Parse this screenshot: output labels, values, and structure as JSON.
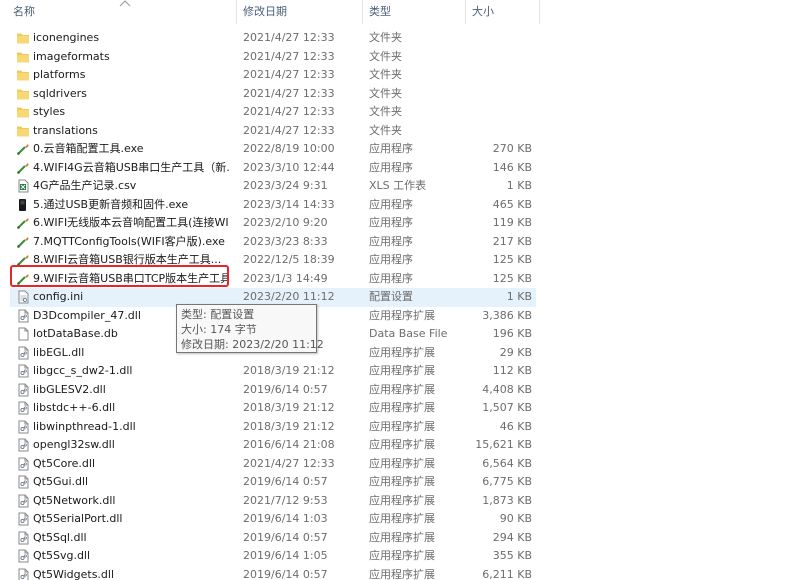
{
  "header": {
    "name": "名称",
    "date": "修改日期",
    "type": "类型",
    "size": "大小"
  },
  "rows": [
    {
      "name": "iconengines",
      "date": "2021/4/27 12:33",
      "type": "文件夹",
      "size": "",
      "icon": "folder-icon"
    },
    {
      "name": "imageformats",
      "date": "2021/4/27 12:33",
      "type": "文件夹",
      "size": "",
      "icon": "folder-icon"
    },
    {
      "name": "platforms",
      "date": "2021/4/27 12:33",
      "type": "文件夹",
      "size": "",
      "icon": "folder-icon"
    },
    {
      "name": "sqldrivers",
      "date": "2021/4/27 12:33",
      "type": "文件夹",
      "size": "",
      "icon": "folder-icon"
    },
    {
      "name": "styles",
      "date": "2021/4/27 12:33",
      "type": "文件夹",
      "size": "",
      "icon": "folder-icon"
    },
    {
      "name": "translations",
      "date": "2021/4/27 12:33",
      "type": "文件夹",
      "size": "",
      "icon": "folder-icon"
    },
    {
      "name": "0.云音箱配置工具.exe",
      "date": "2022/8/19 10:00",
      "type": "应用程序",
      "size": "270 KB",
      "icon": "app-icon"
    },
    {
      "name": "4.WIFI4G云音箱USB串口生产工具（新...",
      "date": "2023/3/10 12:44",
      "type": "应用程序",
      "size": "146 KB",
      "icon": "app-icon"
    },
    {
      "name": "4G产品生产记录.csv",
      "date": "2023/3/24 9:31",
      "type": "XLS 工作表",
      "size": "1 KB",
      "icon": "csv-icon"
    },
    {
      "name": "5.通过USB更新音频和固件.exe",
      "date": "2023/3/14 14:33",
      "type": "应用程序",
      "size": "465 KB",
      "icon": "exe-icon"
    },
    {
      "name": "6.WIFI无线版本云音响配置工具(连接WI...",
      "date": "2023/2/10 9:20",
      "type": "应用程序",
      "size": "119 KB",
      "icon": "app-icon"
    },
    {
      "name": "7.MQTTConfigTools(WIFI客户版).exe",
      "date": "2023/3/23 8:33",
      "type": "应用程序",
      "size": "217 KB",
      "icon": "app-icon"
    },
    {
      "name": "8.WIFI云音箱USB银行版本生产工具...",
      "date": "2022/12/5 18:39",
      "type": "应用程序",
      "size": "125 KB",
      "icon": "app-icon"
    },
    {
      "name": "9.WIFI云音箱USB串口TCP版本生产工具...",
      "date": "2023/1/3 14:49",
      "type": "应用程序",
      "size": "125 KB",
      "icon": "app-icon"
    },
    {
      "name": "config.ini",
      "date": "2023/2/20 11:12",
      "type": "配置设置",
      "size": "1 KB",
      "icon": "ini-file-icon"
    },
    {
      "name": "D3Dcompiler_47.dll",
      "date": "",
      "type": "应用程序扩展",
      "size": "3,386 KB",
      "icon": "dll-icon"
    },
    {
      "name": "IotDataBase.db",
      "date": "",
      "type": "Data Base File",
      "size": "196 KB",
      "icon": "db-file-icon"
    },
    {
      "name": "libEGL.dll",
      "date": "",
      "type": "应用程序扩展",
      "size": "29 KB",
      "icon": "dll-icon"
    },
    {
      "name": "libgcc_s_dw2-1.dll",
      "date": "2018/3/19 21:12",
      "type": "应用程序扩展",
      "size": "112 KB",
      "icon": "dll-icon"
    },
    {
      "name": "libGLESV2.dll",
      "date": "2019/6/14 0:57",
      "type": "应用程序扩展",
      "size": "4,408 KB",
      "icon": "dll-icon"
    },
    {
      "name": "libstdc++-6.dll",
      "date": "2018/3/19 21:12",
      "type": "应用程序扩展",
      "size": "1,507 KB",
      "icon": "dll-icon"
    },
    {
      "name": "libwinpthread-1.dll",
      "date": "2018/3/19 21:12",
      "type": "应用程序扩展",
      "size": "46 KB",
      "icon": "dll-icon"
    },
    {
      "name": "opengl32sw.dll",
      "date": "2016/6/14 21:08",
      "type": "应用程序扩展",
      "size": "15,621 KB",
      "icon": "dll-icon"
    },
    {
      "name": "Qt5Core.dll",
      "date": "2021/4/27 12:33",
      "type": "应用程序扩展",
      "size": "6,564 KB",
      "icon": "dll-icon"
    },
    {
      "name": "Qt5Gui.dll",
      "date": "2019/6/14 0:57",
      "type": "应用程序扩展",
      "size": "6,775 KB",
      "icon": "dll-icon"
    },
    {
      "name": "Qt5Network.dll",
      "date": "2021/7/12 9:53",
      "type": "应用程序扩展",
      "size": "1,873 KB",
      "icon": "dll-icon"
    },
    {
      "name": "Qt5SerialPort.dll",
      "date": "2019/6/14 1:03",
      "type": "应用程序扩展",
      "size": "90 KB",
      "icon": "dll-icon"
    },
    {
      "name": "Qt5Sql.dll",
      "date": "2019/6/14 0:57",
      "type": "应用程序扩展",
      "size": "294 KB",
      "icon": "dll-icon"
    },
    {
      "name": "Qt5Svg.dll",
      "date": "2019/6/14 1:05",
      "type": "应用程序扩展",
      "size": "355 KB",
      "icon": "dll-icon"
    },
    {
      "name": "Qt5Widgets.dll",
      "date": "2019/6/14 0:57",
      "type": "应用程序扩展",
      "size": "6,211 KB",
      "icon": "dll-icon"
    }
  ],
  "tooltip": {
    "type_line": "类型: 配置设置",
    "size_line": "大小: 174 字节",
    "date_line": "修改日期: 2023/2/20 11:12"
  },
  "colors": {
    "hover_row": "#e5f1fb",
    "highlight_box": "#e8262a",
    "folder": "#f3c85a",
    "header_text": "#4c607a"
  }
}
